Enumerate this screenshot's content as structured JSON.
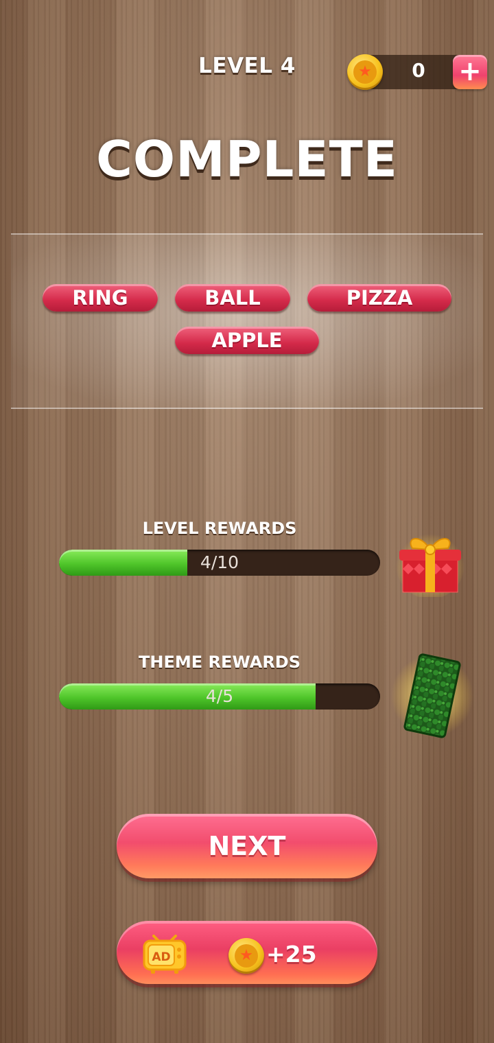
{
  "header": {
    "level_label": "LEVEL 4",
    "coins": "0",
    "add_coins_symbol": "+"
  },
  "title": "COMPLETE",
  "words": [
    "RING",
    "BALL",
    "PIZZA",
    "APPLE"
  ],
  "rewards": {
    "level": {
      "label": "LEVEL REWARDS",
      "progress_text": "4/10",
      "current": 4,
      "total": 10,
      "icon": "gift-box-icon"
    },
    "theme": {
      "label": "THEME REWARDS",
      "progress_text": "4/5",
      "current": 4,
      "total": 5,
      "icon": "theme-card-icon"
    }
  },
  "buttons": {
    "next_label": "NEXT",
    "ad_icon_text": "AD",
    "ad_reward": "+25"
  },
  "colors": {
    "word_pill": "#d42a4a",
    "progress_fill": "#4fc52a",
    "button_pink": "#f24d6d",
    "coin_gold": "#f7c21e"
  }
}
